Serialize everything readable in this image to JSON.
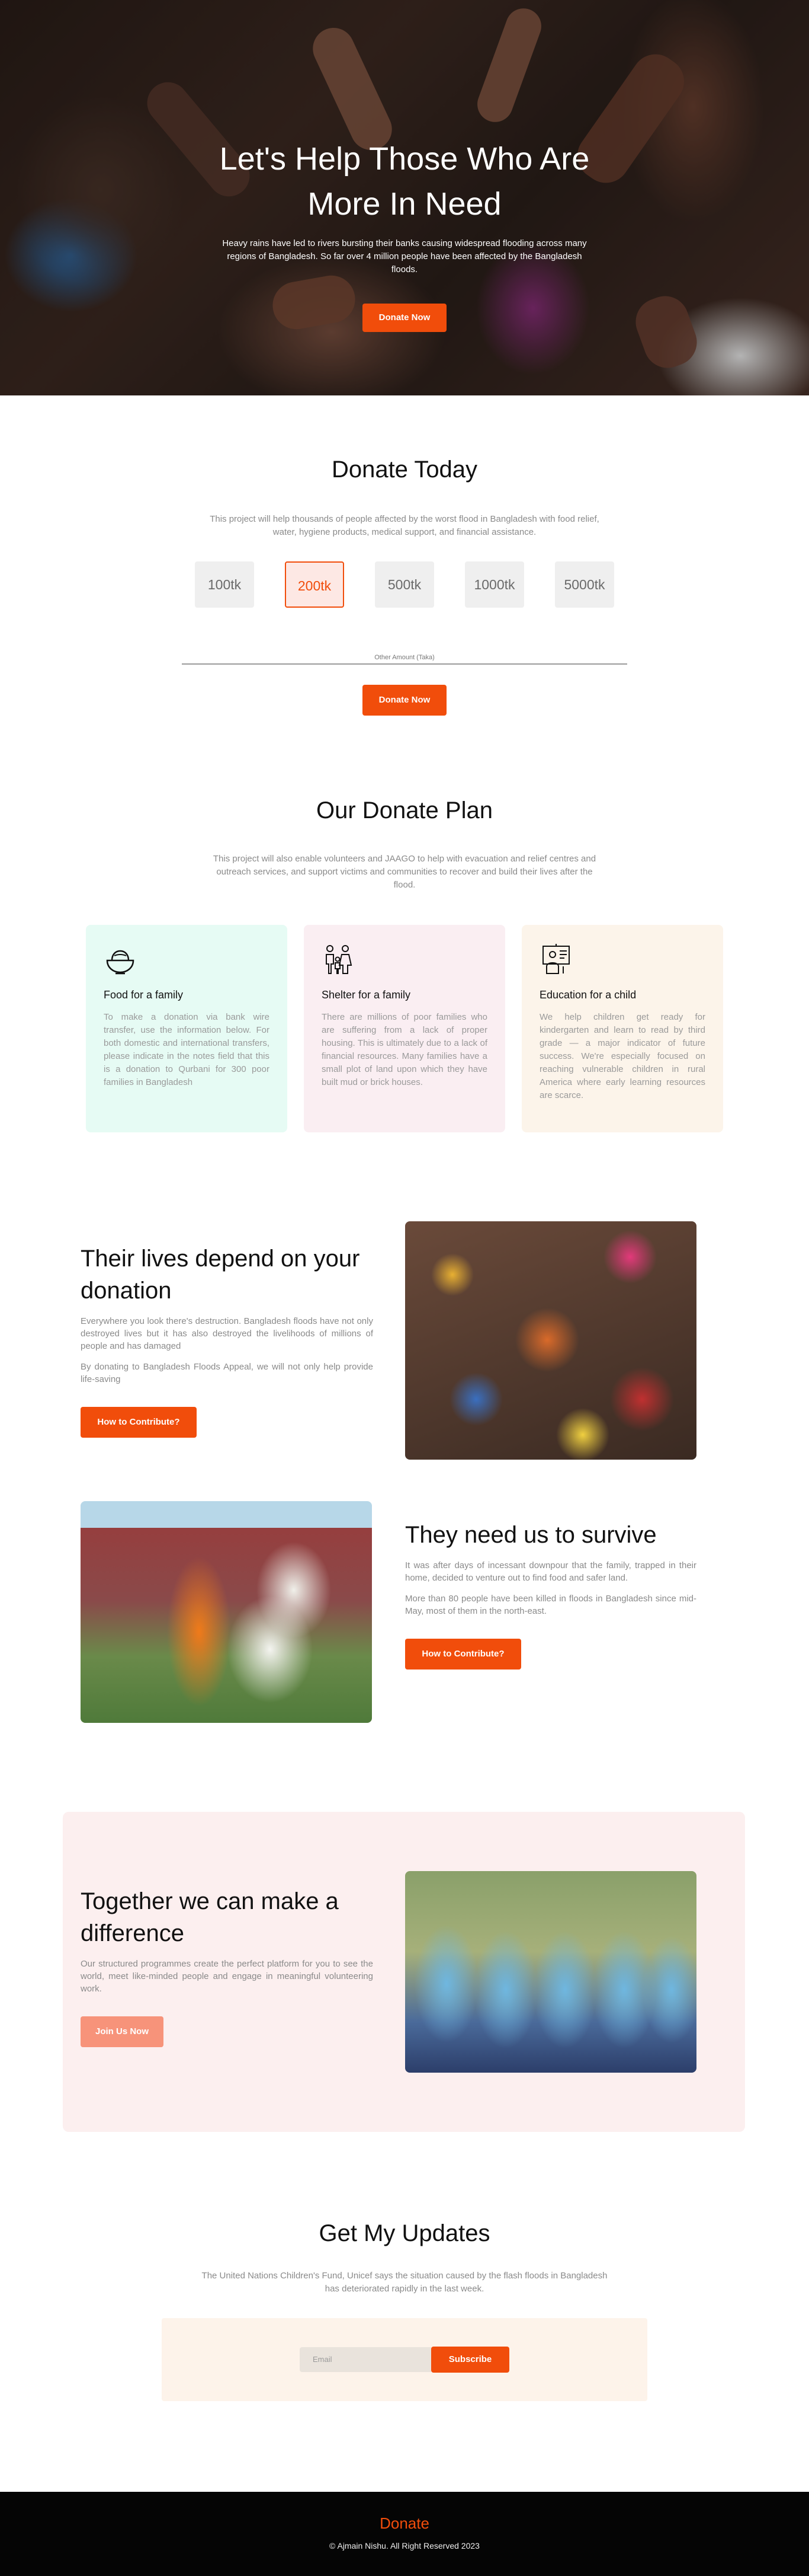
{
  "hero": {
    "title": "Let's Help Those Who Are More In Need",
    "subtitle": "Heavy rains have led to rivers bursting their banks causing widespread flooding across many regions of Bangladesh. So far over 4 million people have been affected by the Bangladesh floods.",
    "button": "Donate Now"
  },
  "donate_today": {
    "title": "Donate Today",
    "subtitle": "This project will help thousands of people affected by the worst flood in Bangladesh with food relief, water, hygiene products, medical support, and financial assistance.",
    "amounts": [
      "100tk",
      "200tk",
      "500tk",
      "1000tk",
      "5000tk"
    ],
    "selected_amount": "200tk",
    "other_amount_label": "Other Amount (Taka)",
    "button": "Donate Now"
  },
  "donate_plan": {
    "title": "Our Donate Plan",
    "subtitle": "This project will also enable volunteers and JAAGO to help with evacuation and relief centres and outreach services, and support victims and communities to recover and build their lives after the flood.",
    "cards": [
      {
        "icon": "food-bowl-icon",
        "title": "Food for a family",
        "text": "To make a donation via bank wire transfer, use the information below. For both domestic and international transfers, please indicate in the notes field that this is a donation to Qurbani for 300 poor families in Bangladesh",
        "bg": "#e6fbf4"
      },
      {
        "icon": "family-icon",
        "title": "Shelter for a family",
        "text": "There are millions of poor families who are suffering from a lack of proper housing. This is ultimately due to a lack of financial resources. Many families have a small plot of land upon which they have built mud or brick houses.",
        "bg": "#faeef2"
      },
      {
        "icon": "education-board-icon",
        "title": "Education for a child",
        "text": "We help children get ready for kindergarten and learn to read by third grade — a major indicator of future success. We're especially focused on reaching vulnerable children in rural America where early learning resources are scarce.",
        "bg": "#fcf4ea"
      }
    ]
  },
  "lives": {
    "title": "Their lives depend on your donation",
    "p1": "Everywhere you look there's destruction. Bangladesh floods have not only destroyed lives but it has also destroyed the livelihoods of millions of people and has damaged",
    "p2": "By donating to Bangladesh Floods Appeal, we will not only help provide life-saving",
    "button": "How to Contribute?"
  },
  "survive": {
    "title": "They need us to survive",
    "p1": "It was after days of incessant downpour that the family, trapped in their home, decided to venture out to find food and safer land.",
    "p2": "More than 80 people have been killed in floods in Bangladesh since mid-May, most of them in the north-east.",
    "button": "How to Contribute?"
  },
  "together": {
    "title": "Together we can make a difference",
    "text": "Our structured programmes create the perfect platform for you to see the world, meet like-minded people and engage in meaningful volunteering work.",
    "button": "Join Us Now"
  },
  "updates": {
    "title": "Get My Updates",
    "subtitle": "The United Nations Children's Fund, Unicef says the situation caused by the flash floods in Bangladesh has deteriorated rapidly in the last week.",
    "email_placeholder": "Email",
    "button": "Subscribe"
  },
  "footer": {
    "brand": "Donate",
    "copyright": "© Ajmain Nishu. All Right Reserved 2023"
  },
  "colors": {
    "accent": "#f14d0b",
    "join_button": "#f7937a"
  }
}
